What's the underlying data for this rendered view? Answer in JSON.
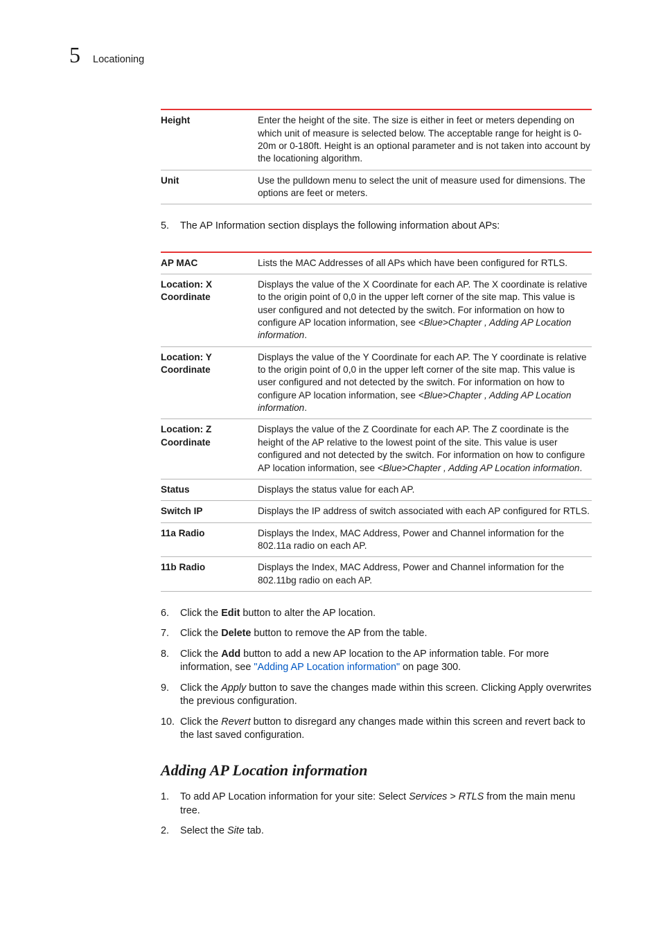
{
  "header": {
    "chapter_number": "5",
    "chapter_title": "Locationing"
  },
  "table1": [
    {
      "label": "Height",
      "value": "Enter the height of the site. The size is either in feet or meters depending on which unit of measure is selected below. The acceptable range for height is 0-20m or 0-180ft. Height is an optional parameter and is not taken into account by the locationing algorithm."
    },
    {
      "label": "Unit",
      "value": "Use the pulldown menu to select the unit of measure used for dimensions. The options are feet or meters."
    }
  ],
  "step5": {
    "num": "5.",
    "text": "The AP Information section displays the following information about APs:"
  },
  "table2": [
    {
      "label": "AP MAC",
      "value": "Lists the MAC Addresses of all APs which have been configured for RTLS."
    },
    {
      "label": "Location: X Coordinate",
      "value": "Displays the value of the X Coordinate for each AP. The X coordinate is relative to the origin point of 0,0 in the upper left corner of the site map. This value is user configured and not detected by the switch. For information on how to configure AP location information, see ",
      "ref": "<Blue>Chapter , Adding AP Location information",
      "value_after": "."
    },
    {
      "label": "Location: Y Coordinate",
      "value": "Displays the value of the Y Coordinate for each AP. The Y coordinate is relative to the origin point of 0,0 in the upper left corner of the site map. This value is user configured and not detected by the switch. For information on how to configure AP location information, see ",
      "ref": "<Blue>Chapter , Adding AP Location information",
      "value_after": "."
    },
    {
      "label": "Location: Z Coordinate",
      "value": "Displays the value of the Z Coordinate for each AP. The Z coordinate is the height of the AP relative to the lowest point of the site. This value is user configured and not detected by the switch. For information on how to configure AP location information, see ",
      "ref": "<Blue>Chapter , Adding AP Location information",
      "value_after": "."
    },
    {
      "label": "Status",
      "value": "Displays the status value for each AP."
    },
    {
      "label": "Switch IP",
      "value": "Displays the IP address of switch associated with each AP configured for RTLS."
    },
    {
      "label": "11a Radio",
      "value": "Displays the Index, MAC Address, Power and Channel information for the 802.11a radio on each AP."
    },
    {
      "label": "11b Radio",
      "value": "Displays the Index, MAC Address, Power and Channel information for the 802.11bg radio on each AP."
    }
  ],
  "steps_after": [
    {
      "num": "6.",
      "pre": "Click the ",
      "bold": "Edit",
      "post": " button to alter the AP location."
    },
    {
      "num": "7.",
      "pre": "Click the ",
      "bold": "Delete",
      "post": " button to remove the AP from the table."
    },
    {
      "num": "8.",
      "pre": "Click the ",
      "bold": "Add",
      "post": " button to add a new AP location to the AP information table. For more information, see ",
      "link": "\"Adding AP Location information\"",
      "post2": " on page 300."
    },
    {
      "num": "9.",
      "pre": "Click the ",
      "italic": "Apply",
      "post": " button to save the changes made within this screen. Clicking Apply overwrites the previous configuration."
    },
    {
      "num": "10.",
      "pre": "Click the ",
      "italic": "Revert",
      "post": " button to disregard any changes made within this screen and revert back to the last saved configuration."
    }
  ],
  "section_heading": "Adding AP Location information",
  "steps_section2": [
    {
      "num": "1.",
      "pre": "To add AP Location information for your site: Select ",
      "italic": "Services > RTLS",
      "post": " from the main menu tree."
    },
    {
      "num": "2.",
      "pre": "Select the ",
      "italic": "Site",
      "post": " tab."
    }
  ]
}
